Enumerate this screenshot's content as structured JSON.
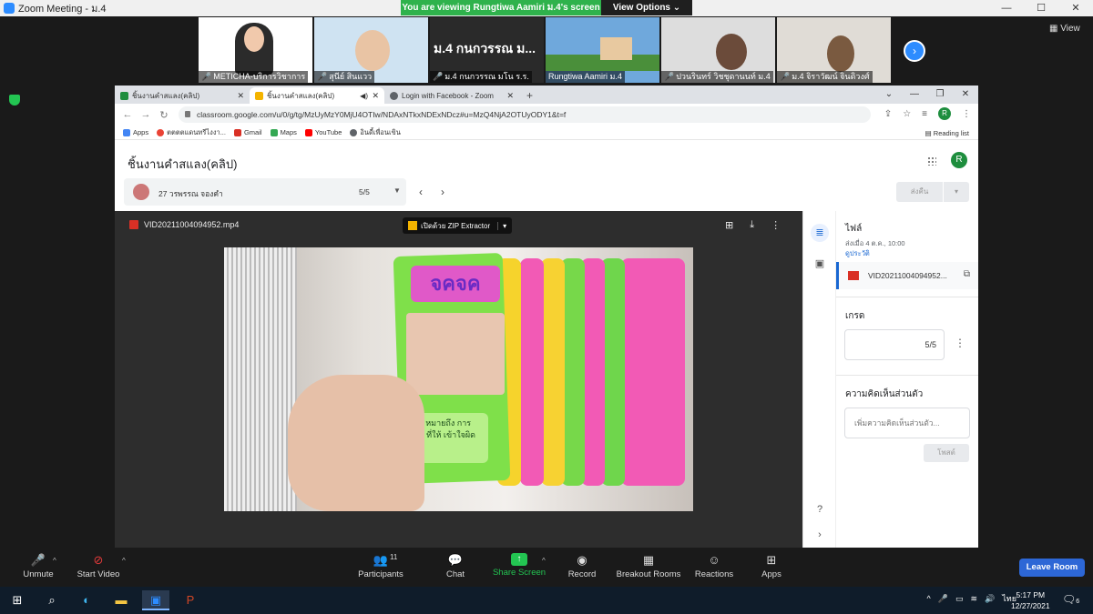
{
  "zoom": {
    "window_title": "Zoom Meeting - ม.4",
    "banner_text": "You are viewing Rungtiwa Aamiri ม.4's screen",
    "view_options": "View Options ⌄",
    "view_label": "View",
    "participants": [
      {
        "name": "METICHA-บริการวิชาการ"
      },
      {
        "name": "สุนีย์ สินแวว"
      },
      {
        "name": "ม.4 กนกวรรณ มโน ร.ร.",
        "big_label": "ม.4 กนกวรรณ ม..."
      },
      {
        "name": "Rungtiwa Aamiri ม.4"
      },
      {
        "name": "ปวนรินทร์ วิชชุดานนท์ ม.4"
      },
      {
        "name": "ม.4 จิราวัฒน์ จินดิวงศ์"
      }
    ],
    "toolbar": {
      "unmute": "Unmute",
      "start_video": "Start Video",
      "participants": "Participants",
      "participants_count": "11",
      "chat": "Chat",
      "share_screen": "Share Screen",
      "record": "Record",
      "breakout_rooms": "Breakout Rooms",
      "reactions": "Reactions",
      "apps": "Apps",
      "leave": "Leave Room"
    }
  },
  "chrome": {
    "tabs": [
      {
        "title": "ชิ้นงานคำสแลง(คลิป)",
        "color": "#1e8e3e"
      },
      {
        "title": "ชิ้นงานคำสแลง(คลิป)",
        "color": "#f4b400"
      },
      {
        "title": "Login with Facebook - Zoom",
        "color": "#5f6368"
      }
    ],
    "url": "classroom.google.com/u/0/g/tg/MzUyMzY0MjU4OTIw/NDAxNTkxNDExNDcz#u=MzQ4NjA2OTUyODY1&t=f",
    "bookmarks": [
      "Apps",
      "ตตตตแดนทรีไงงา...",
      "Gmail",
      "Maps",
      "YouTube",
      "อินดี้เพื่อนเขิน"
    ],
    "reading_list": "Reading list",
    "profile_initial": "R"
  },
  "classroom": {
    "assignment_title": "ชิ้นงานคำสแลง(คลิป)",
    "student_name": "27 วรพรรณ จองคำ",
    "student_grade": "5/5",
    "return_label": "ส่งคืน",
    "file_name": "VID20211004094952.mp4",
    "open_with": "เปิดด้วย ZIP Extractor",
    "video_cover_title": "จคจค",
    "video_caption": "จงคา หมายถึง การโกหก ที่ให้ เข้าใจผิด",
    "side": {
      "files_heading": "ไฟล์",
      "submitted_on": "ส่งเมื่อ 4 ต.ค., 10:00",
      "history_link": "ดูประวัติ",
      "file_short": "VID20211004094952...",
      "grade_heading": "เกรด",
      "grade_value": "5/5",
      "comments_heading": "ความคิดเห็นส่วนตัว",
      "comment_placeholder": "เพิ่มความคิดเห็นส่วนตัว...",
      "post_label": "โพสต์"
    }
  },
  "taskbar": {
    "lang": "ไทย",
    "time": "5:17 PM",
    "date": "12/27/2021",
    "notif_count": "6"
  }
}
